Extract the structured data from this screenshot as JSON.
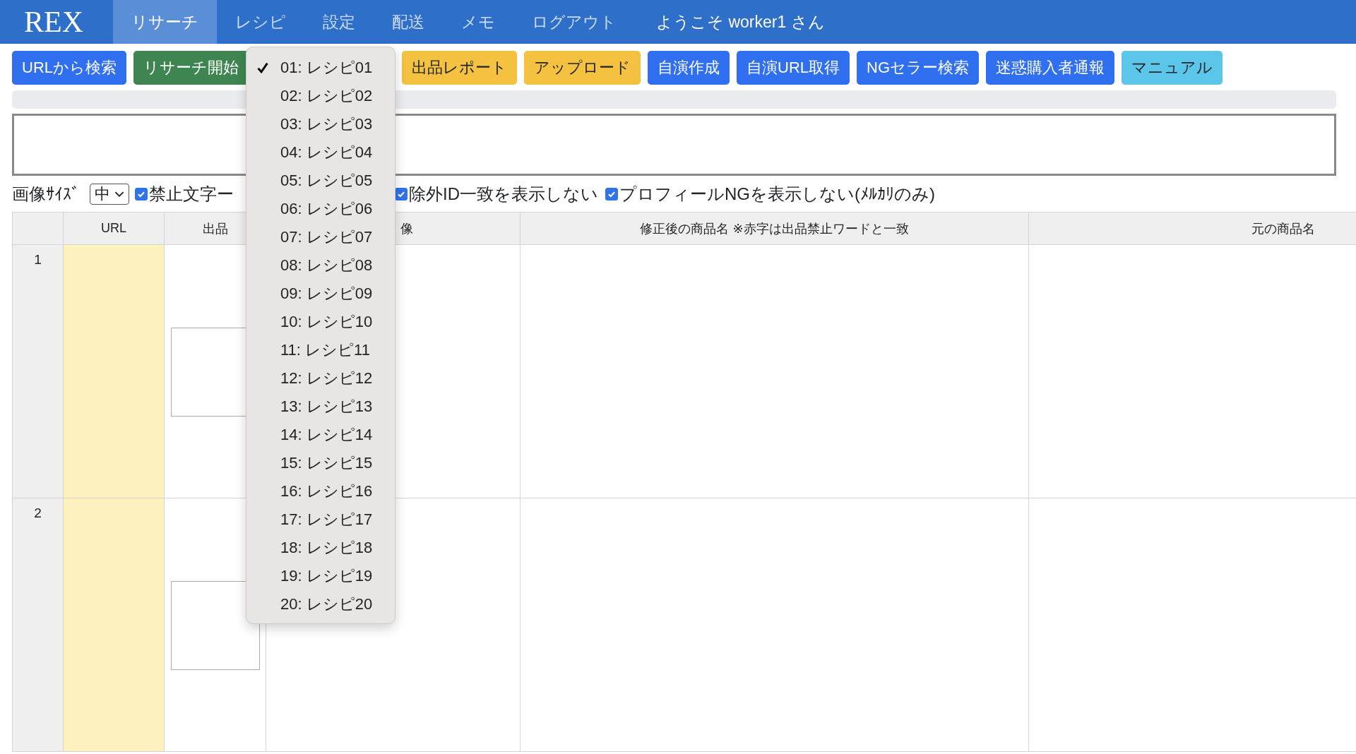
{
  "navbar": {
    "logo": "REX",
    "tabs": [
      {
        "label": "リサーチ",
        "selected": true
      },
      {
        "label": "レシピ",
        "selected": false
      },
      {
        "label": "設定",
        "selected": false
      },
      {
        "label": "配送",
        "selected": false
      },
      {
        "label": "メモ",
        "selected": false
      },
      {
        "label": "ログアウト",
        "selected": false
      }
    ],
    "welcome": "ようこそ worker1 さん"
  },
  "toolbar": {
    "left_buttons": [
      {
        "label": "URLから検索",
        "kind": "primary"
      },
      {
        "label": "リサーチ開始",
        "kind": "success"
      }
    ],
    "right_buttons": [
      {
        "label": "出品レポート",
        "kind": "warning"
      },
      {
        "label": "アップロード",
        "kind": "warning"
      },
      {
        "label": "自演作成",
        "kind": "primary"
      },
      {
        "label": "自演URL取得",
        "kind": "primary"
      },
      {
        "label": "NGセラー検索",
        "kind": "primary"
      },
      {
        "label": "迷惑購入者通報",
        "kind": "primary"
      },
      {
        "label": "マニュアル",
        "kind": "info"
      }
    ]
  },
  "progress": {
    "level": 0
  },
  "filters": {
    "image_size_label": "画像ｻｲｽﾞ",
    "image_size": "中",
    "left_checkboxes": [
      {
        "label": "禁止文字ー",
        "checked": true
      }
    ],
    "right_checkboxes": [
      {
        "label": "除外ID一致を表示しない",
        "checked": true
      },
      {
        "label": "プロフィールNGを表示しない(ﾒﾙｶﾘのみ)",
        "checked": true
      }
    ]
  },
  "table": {
    "columns": [
      "URL",
      "出品",
      "像",
      "修正後の商品名 ※赤字は出品禁止ワードと一致",
      "元の商品名"
    ],
    "rows": [
      {
        "number": "1"
      },
      {
        "number": "2"
      }
    ]
  },
  "recipe_menu": {
    "items": [
      {
        "label": "01: レシピ01",
        "selected": true
      },
      {
        "label": "02: レシピ02",
        "selected": false
      },
      {
        "label": "03: レシピ03",
        "selected": false
      },
      {
        "label": "04: レシピ04",
        "selected": false
      },
      {
        "label": "05: レシピ05",
        "selected": false
      },
      {
        "label": "06: レシピ06",
        "selected": false
      },
      {
        "label": "07: レシピ07",
        "selected": false
      },
      {
        "label": "08: レシピ08",
        "selected": false
      },
      {
        "label": "09: レシピ09",
        "selected": false
      },
      {
        "label": "10: レシピ10",
        "selected": false
      },
      {
        "label": "11: レシピ11",
        "selected": false
      },
      {
        "label": "12: レシピ12",
        "selected": false
      },
      {
        "label": "13: レシピ13",
        "selected": false
      },
      {
        "label": "14: レシピ14",
        "selected": false
      },
      {
        "label": "15: レシピ15",
        "selected": false
      },
      {
        "label": "16: レシピ16",
        "selected": false
      },
      {
        "label": "17: レシピ17",
        "selected": false
      },
      {
        "label": "18: レシピ18",
        "selected": false
      },
      {
        "label": "19: レシピ19",
        "selected": false
      },
      {
        "label": "20: レシピ20",
        "selected": false
      }
    ]
  }
}
